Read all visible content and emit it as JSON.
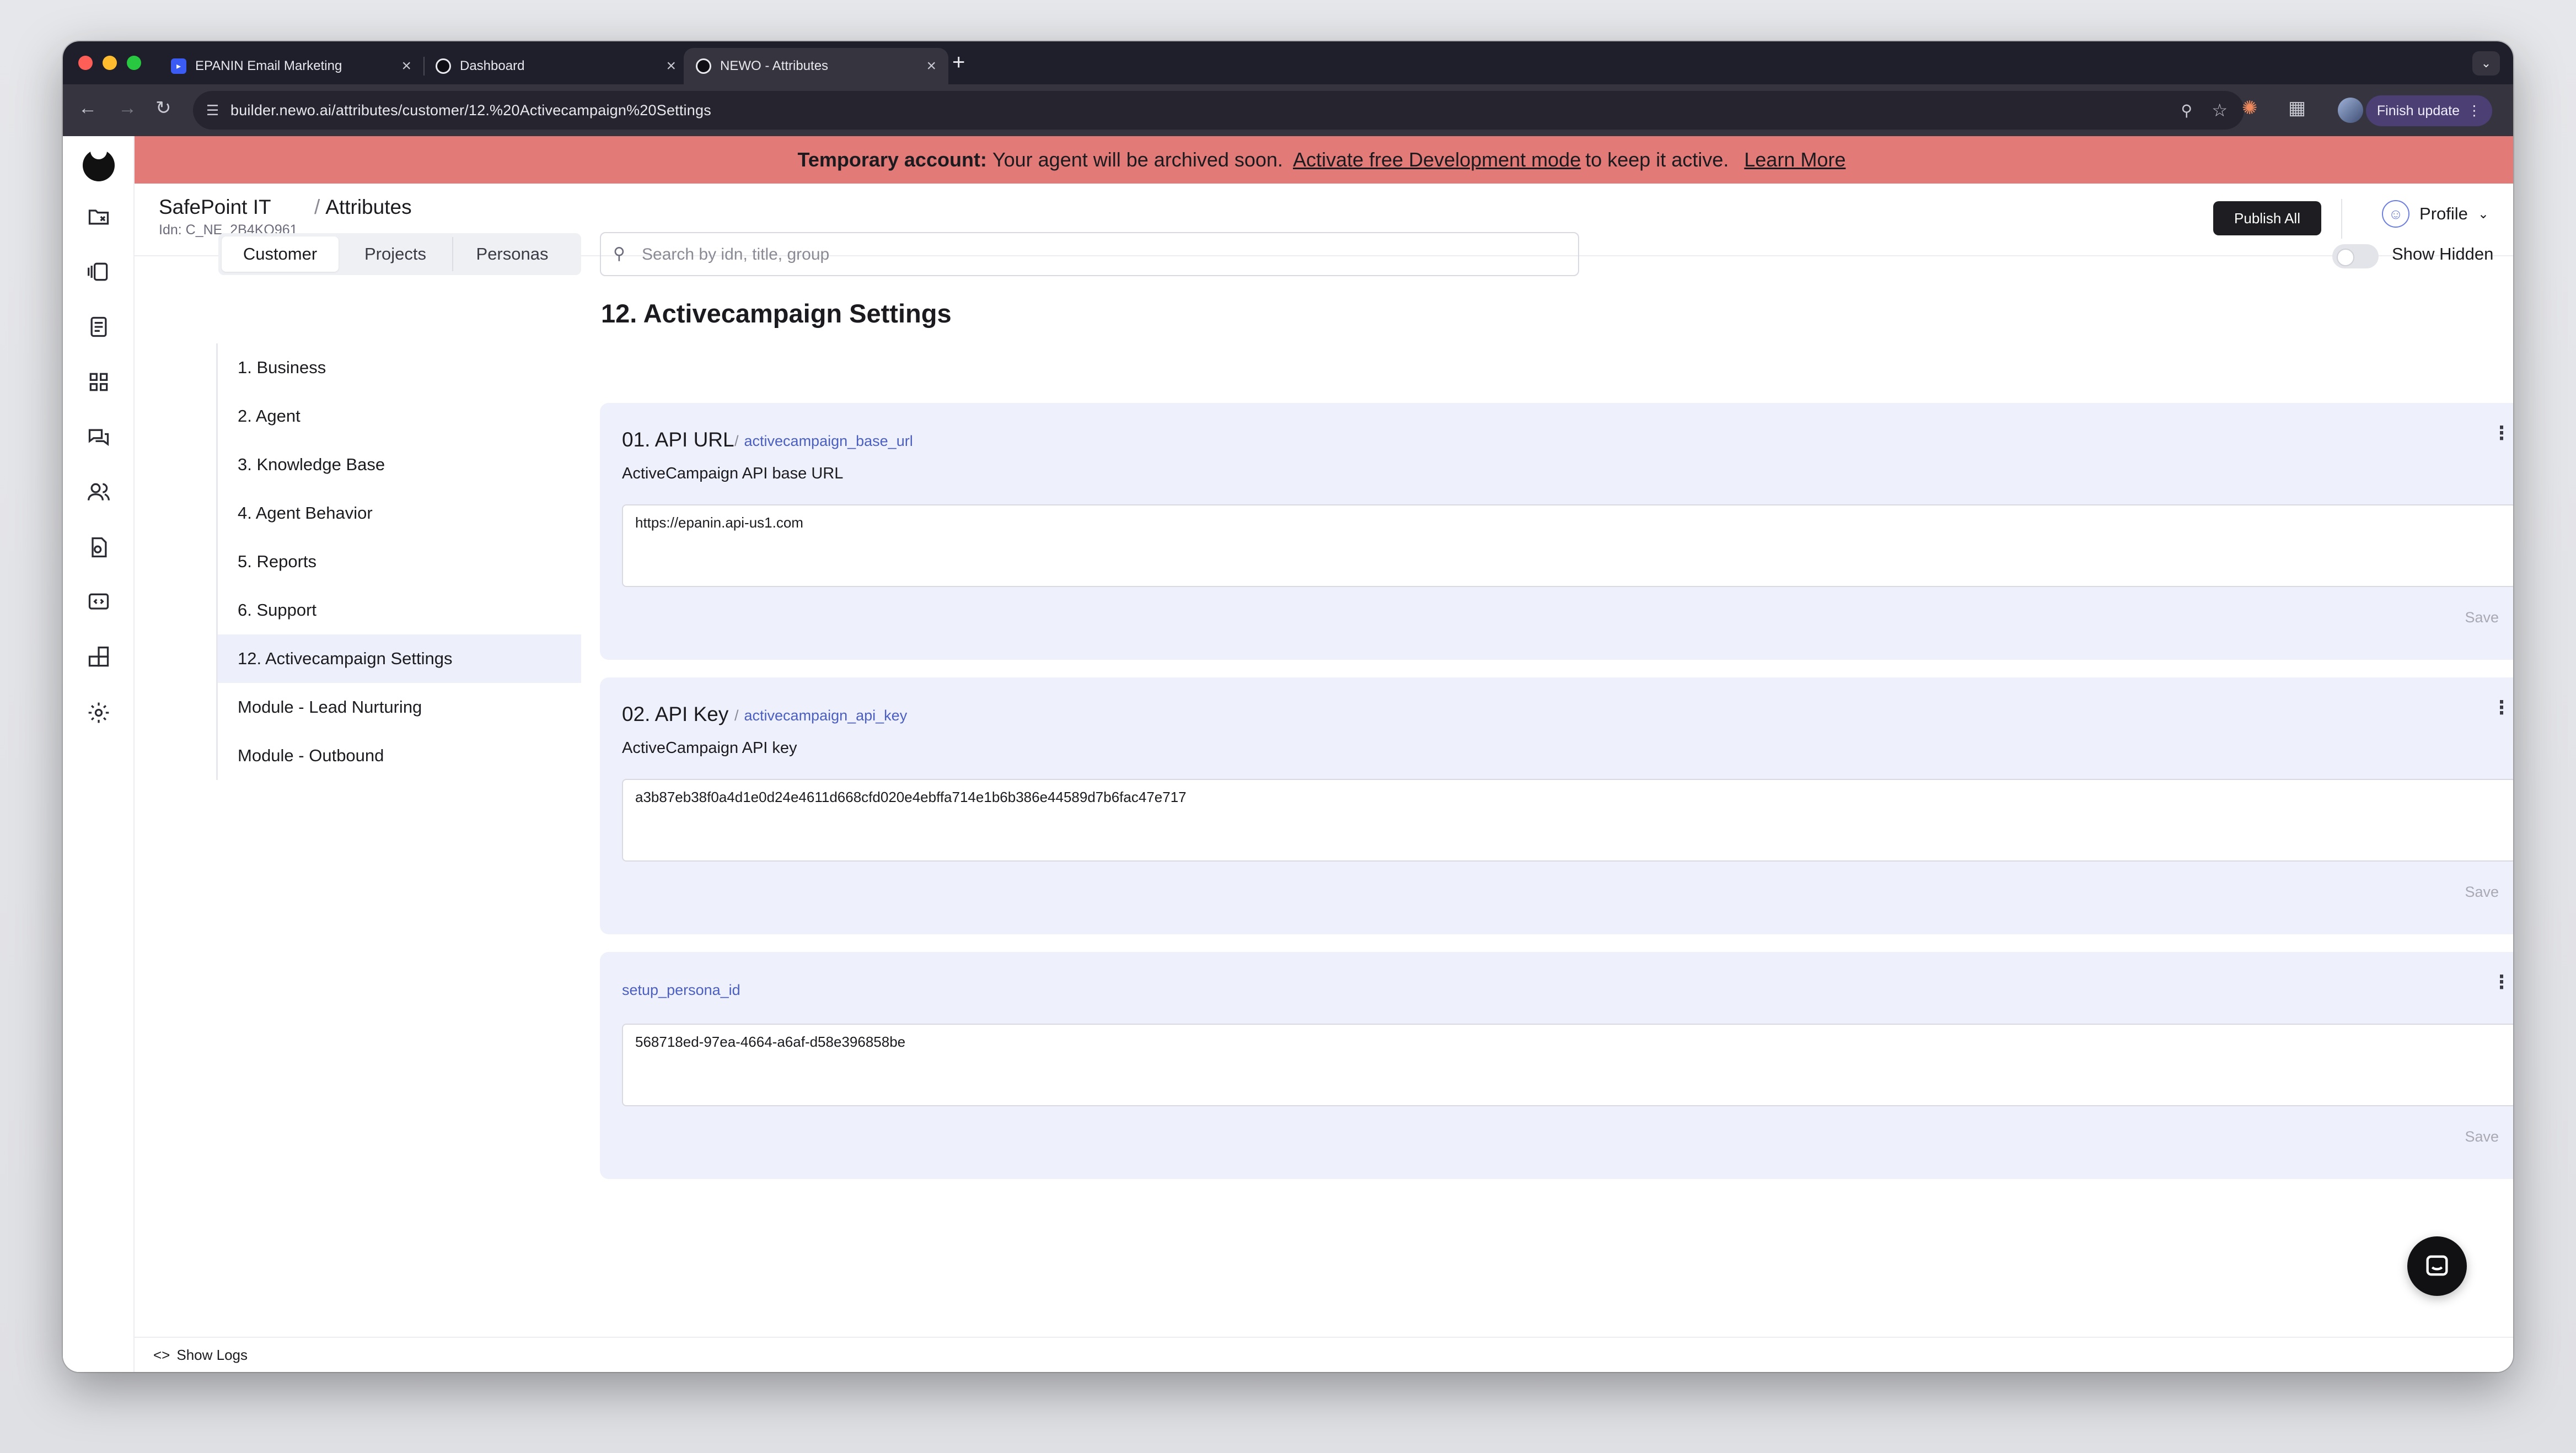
{
  "browser": {
    "tabs": [
      {
        "title": "EPANIN Email Marketing",
        "active": false
      },
      {
        "title": "Dashboard",
        "active": false
      },
      {
        "title": "NEWO - Attributes",
        "active": true
      }
    ],
    "url": "builder.newo.ai/attributes/customer/12.%20Activecampaign%20Settings",
    "finish_update_label": "Finish update"
  },
  "banner": {
    "prefix": "Temporary account:",
    "message": "Your agent will be archived soon.",
    "activate_link": "Activate free Development mode",
    "suffix": "to keep it active.",
    "learn_more": "Learn More",
    "color": "#e27a78"
  },
  "header": {
    "org_name": "SafePoint IT",
    "org_idn": "Idn: C_NE_2B4KQ961",
    "breadcrumb": "Attributes",
    "publish_label": "Publish All",
    "profile_label": "Profile"
  },
  "tabs": [
    "Customer",
    "Projects",
    "Personas"
  ],
  "active_tab": "Customer",
  "search": {
    "placeholder": "Search by idn, title, group"
  },
  "show_hidden_label": "Show Hidden",
  "sidebar": {
    "items": [
      {
        "label": "1. Business"
      },
      {
        "label": "2. Agent"
      },
      {
        "label": "3. Knowledge Base"
      },
      {
        "label": "4. Agent Behavior"
      },
      {
        "label": "5. Reports"
      },
      {
        "label": "6. Support"
      },
      {
        "label": "12. Activecampaign Settings",
        "active": true
      },
      {
        "label": "Module - Lead Nurturing"
      },
      {
        "label": "Module - Outbound"
      }
    ]
  },
  "section_title": "12. Activecampaign Settings",
  "cards": [
    {
      "title": "01. API URL",
      "idn": "activecampaign_base_url",
      "description": "ActiveCampaign API base URL",
      "value": "https://epanin.api-us1.com",
      "save_label": "Save"
    },
    {
      "title": "02. API Key",
      "idn": "activecampaign_api_key",
      "description": "ActiveCampaign API key",
      "value": "a3b87eb38f0a4d1e0d24e4611d668cfd020e4ebffa714e1b6b386e44589d7b6fac47e717",
      "save_label": "Save"
    },
    {
      "title": "",
      "idn": "setup_persona_id",
      "description": "",
      "value": "568718ed-97ea-4664-a6af-d58e396858be",
      "save_label": "Save"
    }
  ],
  "footer": {
    "show_logs_label": "Show Logs"
  }
}
